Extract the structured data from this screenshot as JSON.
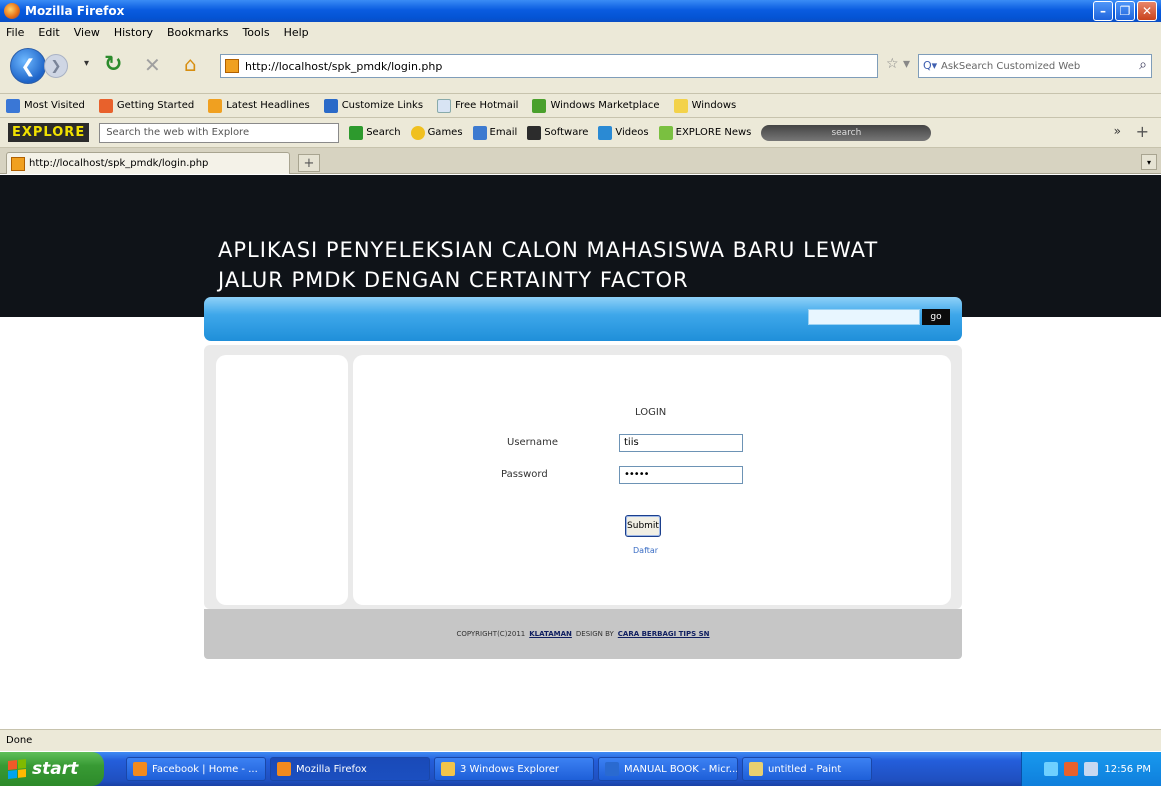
{
  "window": {
    "title": "Mozilla Firefox"
  },
  "menu": [
    "File",
    "Edit",
    "View",
    "History",
    "Bookmarks",
    "Tools",
    "Help"
  ],
  "nav": {
    "url": "http://localhost/spk_pmdk/login.php",
    "search_placeholder": "AskSearch Customized Web"
  },
  "bookmarks": [
    {
      "label": "Most Visited",
      "color": "#3a77d6"
    },
    {
      "label": "Getting Started",
      "color": "#e8612c"
    },
    {
      "label": "Latest Headlines",
      "color": "#f0a020"
    },
    {
      "label": "Customize Links",
      "color": "#2a6ac8"
    },
    {
      "label": "Free Hotmail",
      "color": "#d8e4f4"
    },
    {
      "label": "Windows Marketplace",
      "color": "#4aa02c"
    },
    {
      "label": "Windows",
      "color": "#f3d24a"
    }
  ],
  "toolbar": {
    "logo": "EXPLORE",
    "search_text": "Search the web with Explore",
    "items": [
      {
        "label": "Search",
        "color": "#2d9a2d"
      },
      {
        "label": "Games",
        "color": "#f0c020"
      },
      {
        "label": "Email",
        "color": "#3d7ad0"
      },
      {
        "label": "Software",
        "color": "#2c2c2c"
      },
      {
        "label": "Videos",
        "color": "#2a8ad4"
      },
      {
        "label": "EXPLORE News",
        "color": "#7ac040"
      }
    ],
    "radio": "search",
    "right": "»"
  },
  "tab": {
    "label": "http://localhost/spk_pmdk/login.php"
  },
  "page": {
    "title": "APLIKASI PENYELEKSIAN CALON MAHASISWA BARU LEWAT JALUR PMDK DENGAN CERTAINTY FACTOR",
    "search_button": "go",
    "login": {
      "heading": "LOGIN",
      "username_label": "Username",
      "username_value": "tiis",
      "password_label": "Password",
      "password_value": "•••••",
      "submit": "Submit",
      "register": "Daftar"
    },
    "footer": {
      "prefix": "COPYRIGHT(C)2011",
      "link1": "KLATAMAN",
      "middle": "DESIGN BY",
      "link2": "CARA BERBAGI TIPS SN"
    }
  },
  "status": "Done",
  "taskbar": {
    "start": "start",
    "tasks": [
      {
        "label": "Facebook | Home - ...",
        "color": "#f28a1e",
        "width": 160
      },
      {
        "label": "Mozilla Firefox",
        "color": "#f28a1e",
        "width": 160
      },
      {
        "label": "3 Windows Explorer",
        "color": "#f1c44a",
        "width": 160
      },
      {
        "label": "MANUAL BOOK - Micr...",
        "color": "#2a6ad0",
        "width": 160
      },
      {
        "label": "untitled - Paint",
        "color": "#e8d070",
        "width": 160
      }
    ],
    "clock": "12:56 PM"
  }
}
